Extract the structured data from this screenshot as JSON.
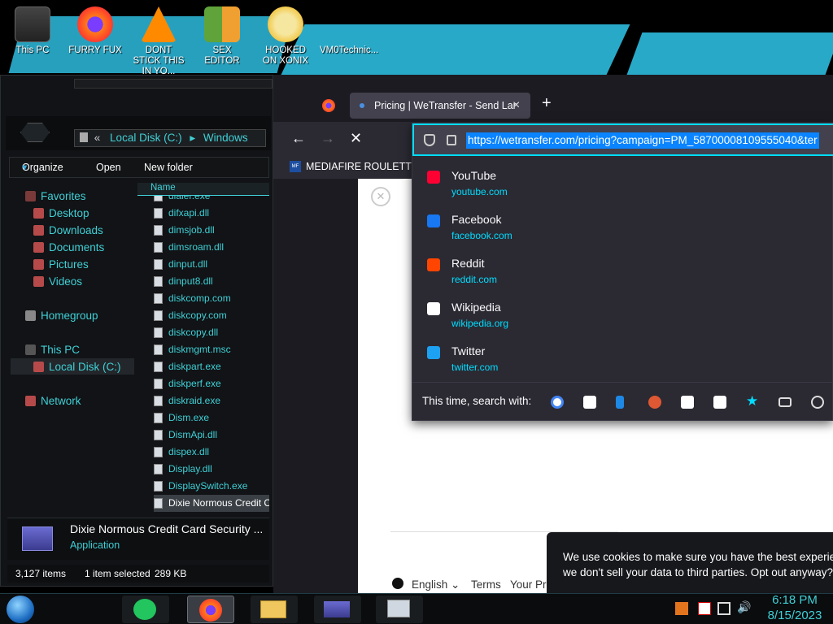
{
  "desktop": {
    "icons": [
      {
        "label": "This PC"
      },
      {
        "label": "FURRY FUX"
      },
      {
        "label": "DONT STICK THIS IN YO..."
      },
      {
        "label": "SEX EDITOR"
      },
      {
        "label": "HOOKED ON XONIX"
      },
      {
        "label": "VM0Technic..."
      }
    ]
  },
  "explorer": {
    "breadcrumb": {
      "back": "«",
      "drive": "Local Disk (C:)",
      "sep": "▸",
      "folder": "Windows"
    },
    "toolbar": {
      "organize": "Organize",
      "open": "Open",
      "new_folder": "New folder"
    },
    "column_header": "Name",
    "nav": {
      "favorites": "Favorites",
      "desktop": "Desktop",
      "downloads": "Downloads",
      "documents": "Documents",
      "pictures": "Pictures",
      "videos": "Videos",
      "homegroup": "Homegroup",
      "this_pc": "This PC",
      "local_disk": "Local Disk (C:)",
      "network": "Network"
    },
    "files": [
      "dialer.exe",
      "difxapi.dll",
      "dimsjob.dll",
      "dimsroam.dll",
      "dinput.dll",
      "dinput8.dll",
      "diskcomp.com",
      "diskcopy.com",
      "diskcopy.dll",
      "diskmgmt.msc",
      "diskpart.exe",
      "diskperf.exe",
      "diskraid.exe",
      "Dism.exe",
      "DismApi.dll",
      "dispex.dll",
      "Display.dll",
      "DisplaySwitch.exe",
      "Dixie Normous Credit Ca"
    ],
    "details": {
      "name": "Dixie Normous Credit Card Security ...",
      "type": "Application"
    },
    "status": {
      "items": "3,127 items",
      "selected": "1 item selected",
      "size": "289 KB"
    }
  },
  "browser": {
    "tab_title": "Pricing | WeTransfer - Send Lar",
    "tab_close": "×",
    "new_tab": "+",
    "url": "https://wetransfer.com/pricing?campaign=PM_58700008109555040&ter",
    "bookmark": "MEDIAFIRE ROULETTER",
    "bookmark_badge": "MF",
    "suggestions": [
      {
        "title": "YouTube",
        "url": "youtube.com",
        "icon_color": "#ff0033"
      },
      {
        "title": "Facebook",
        "url": "facebook.com",
        "icon_color": "#1877f2"
      },
      {
        "title": "Reddit",
        "url": "reddit.com",
        "icon_color": "#ff4500"
      },
      {
        "title": "Wikipedia",
        "url": "wikipedia.org",
        "icon_color": "#ffffff"
      },
      {
        "title": "Twitter",
        "url": "twitter.com",
        "icon_color": "#1da1f2"
      }
    ],
    "search_with": "This time, search with:",
    "page_footer": {
      "language": "English",
      "terms": "Terms",
      "privacy": "Your Pr"
    },
    "cookie_text_1": "We use cookies to make sure you have the best experien",
    "cookie_text_2": "we don't sell your data to third parties. Opt out anyway? "
  },
  "taskbar": {
    "time": "6:18 PM",
    "date": "8/15/2023"
  }
}
